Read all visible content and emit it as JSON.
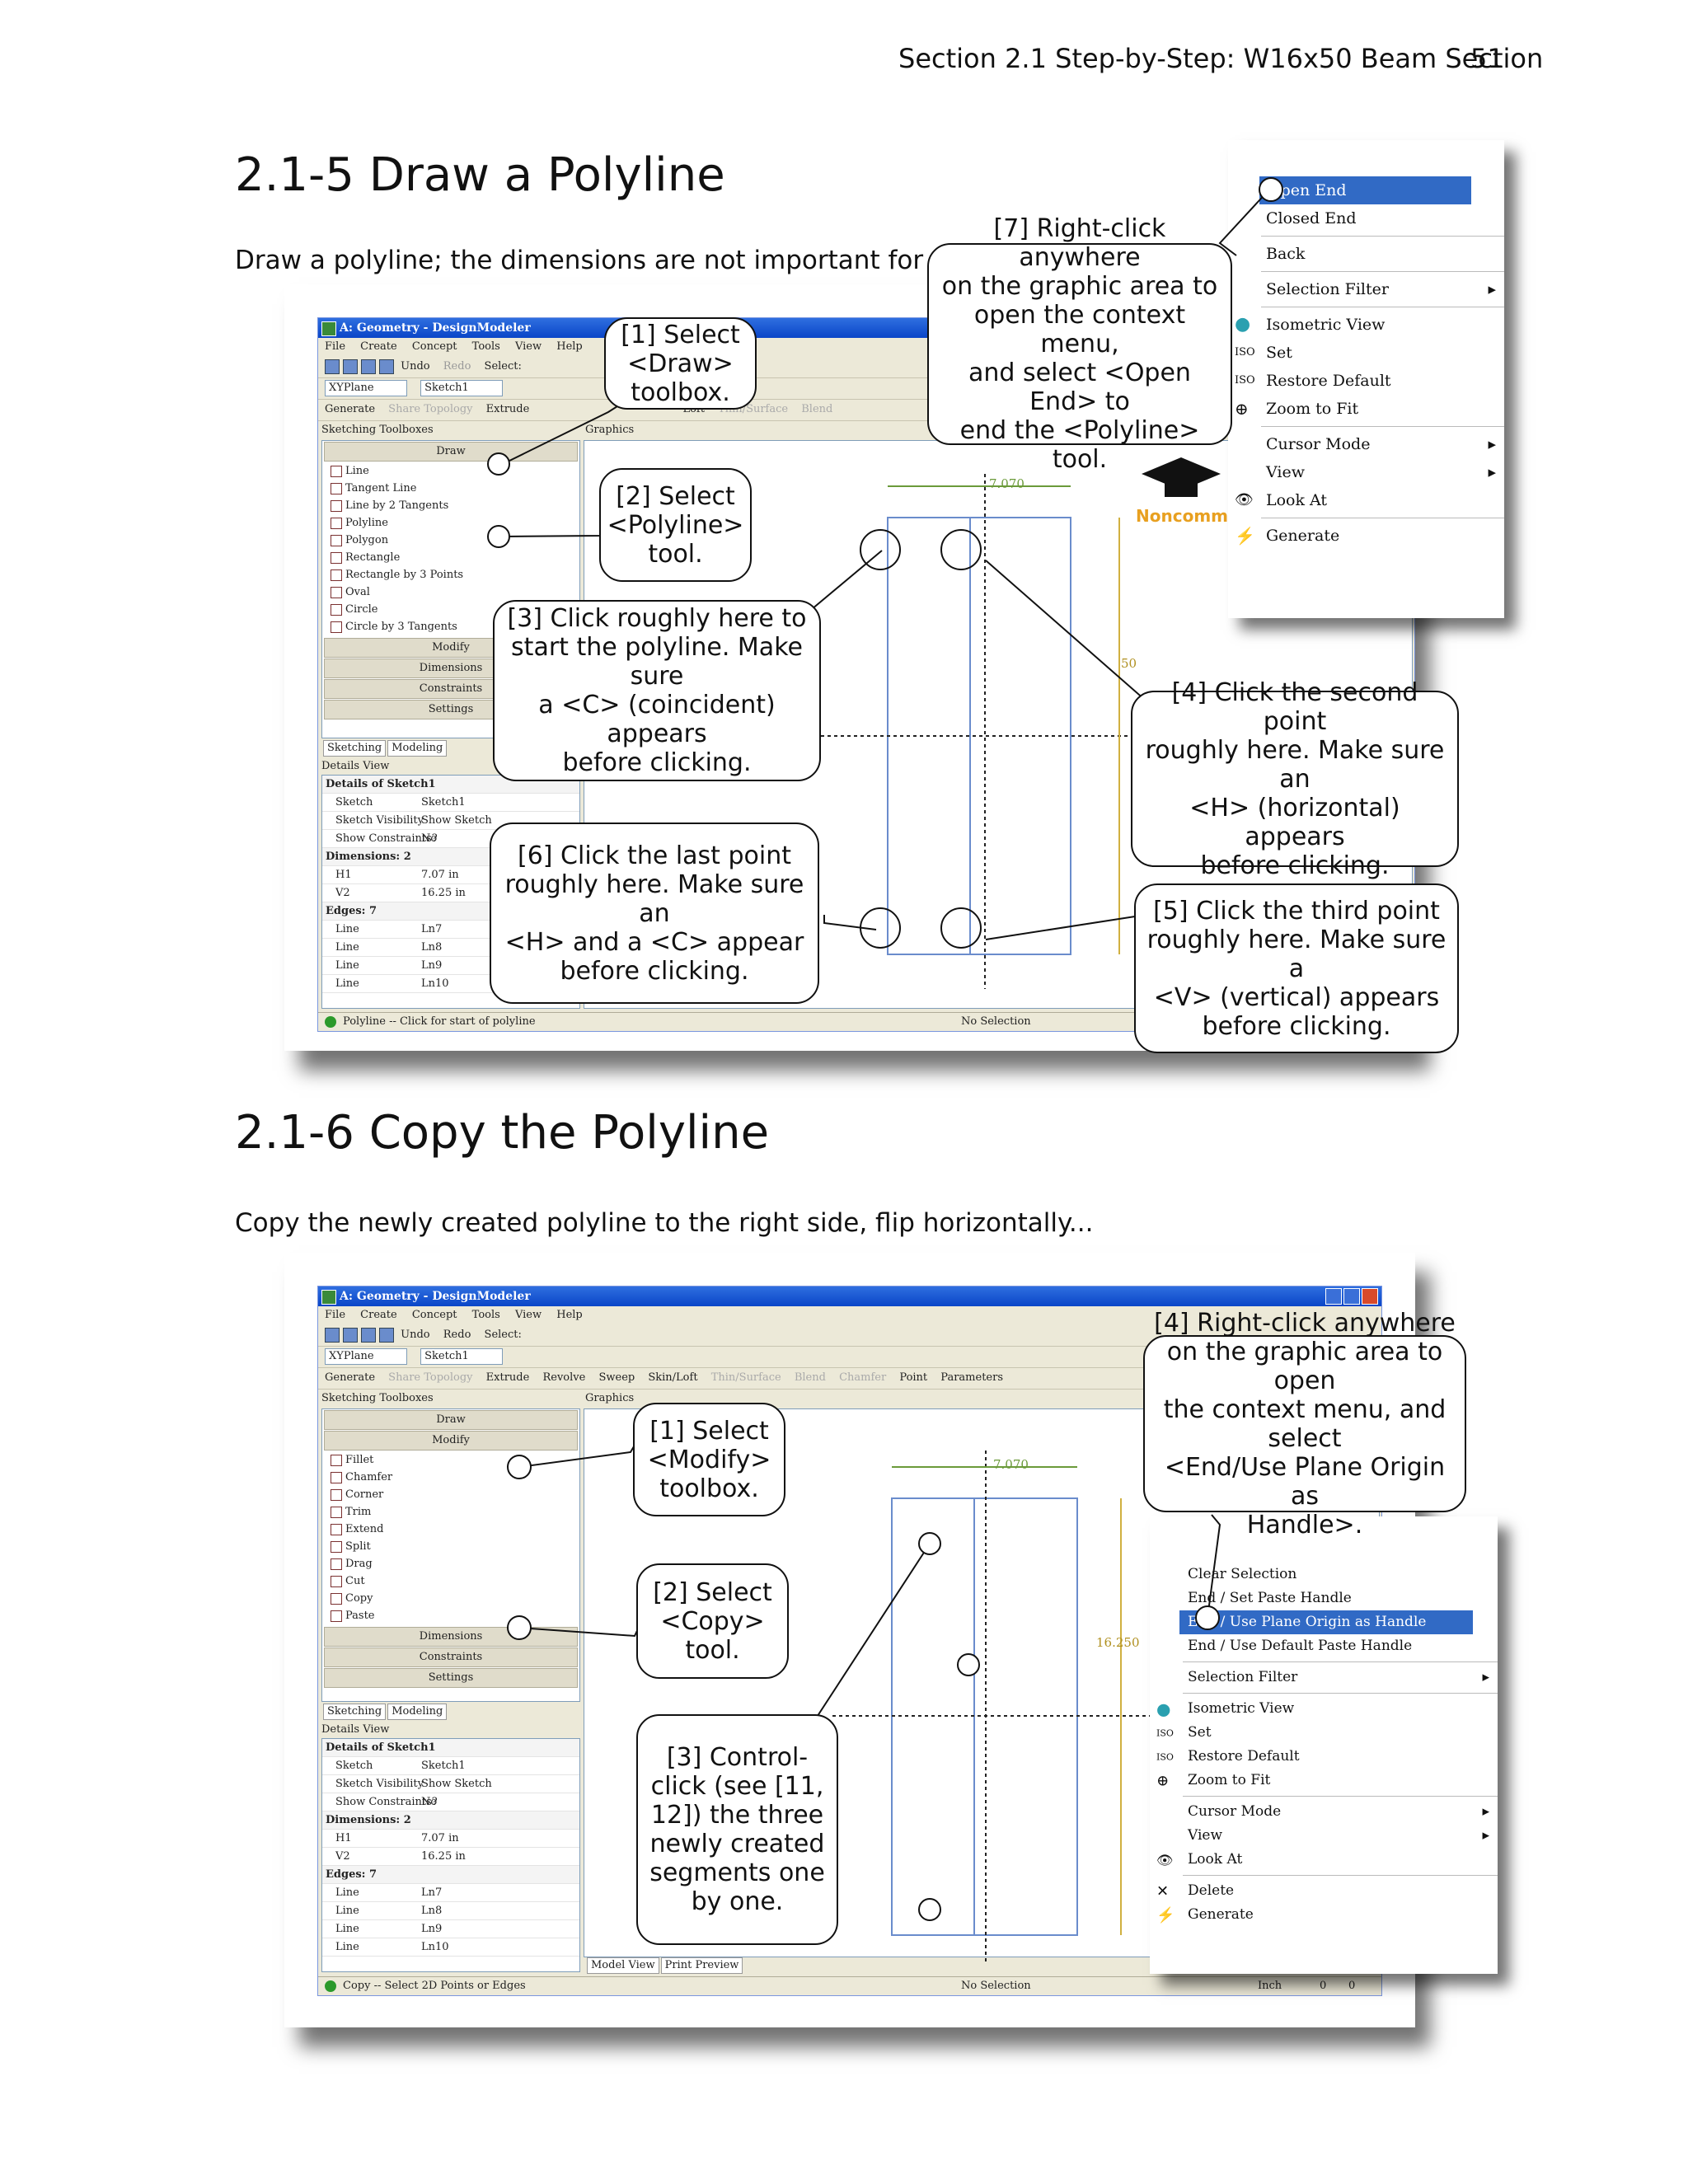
{
  "running_head": "Section 2.1  Step-by-Step: W16x50 Beam Section",
  "page_number": "51",
  "section1": {
    "heading": "2.1-5  Draw a Polyline",
    "intro": "Draw a polyline; the dimensions are not important for now...",
    "window": {
      "title": "A: Geometry - DesignModeler",
      "menu": [
        "File",
        "Create",
        "Concept",
        "Tools",
        "View",
        "Help"
      ],
      "toolbar1": {
        "undo": "Undo",
        "redo": "Redo",
        "select": "Select:"
      },
      "plane": "XYPlane",
      "sketch": "Sketch1",
      "toolbar3": {
        "generate": "Generate",
        "show_topology": "Share Topology",
        "extrude": "Extrude",
        "loft": "Loft",
        "thin": "Thin/Surface",
        "blend": "Blend"
      },
      "toolboxes_label": "Sketching Toolboxes",
      "graphics_label": "Graphics",
      "draw_header": "Draw",
      "tools": [
        "Line",
        "Tangent Line",
        "Line by 2 Tangents",
        "Polyline",
        "Polygon",
        "Rectangle",
        "Rectangle by 3 Points",
        "Oval",
        "Circle",
        "Circle by 3 Tangents"
      ],
      "other_headers": [
        "Modify",
        "Dimensions",
        "Constraints",
        "Settings"
      ],
      "tabs": [
        "Sketching",
        "Modeling"
      ],
      "details_label": "Details View",
      "details": [
        {
          "k": "Details of Sketch1",
          "v": "",
          "grp": true
        },
        {
          "k": "Sketch",
          "v": "Sketch1"
        },
        {
          "k": "Sketch Visibility",
          "v": "Show Sketch"
        },
        {
          "k": "Show Constraints?",
          "v": "No"
        },
        {
          "k": "Dimensions: 2",
          "v": "",
          "grp": true
        },
        {
          "k": "H1",
          "v": "7.07 in"
        },
        {
          "k": "V2",
          "v": "16.25 in"
        },
        {
          "k": "Edges: 7",
          "v": "",
          "grp": true
        },
        {
          "k": "Line",
          "v": "Ln7"
        },
        {
          "k": "Line",
          "v": "Ln8"
        },
        {
          "k": "Line",
          "v": "Ln9"
        },
        {
          "k": "Line",
          "v": "Ln10"
        }
      ],
      "status_left": "Polyline -- Click for start of polyline",
      "status_mid": "No Selection",
      "dim_h": "7.070",
      "dim_v": "50",
      "watermark": "Noncomm"
    },
    "context_menu": {
      "items": [
        "Open End",
        "Closed End",
        "Back",
        "Selection Filter",
        "Isometric View",
        "Set",
        "Restore Default",
        "Zoom to Fit",
        "Cursor Mode",
        "View",
        "Look At",
        "Generate"
      ]
    },
    "callouts": {
      "c1": [
        "[1] Select",
        "<Draw>",
        "toolbox."
      ],
      "c2": [
        "[2] Select",
        "<Polyline>",
        "tool."
      ],
      "c3": [
        "[3] Click roughly here to",
        "start the polyline.  Make sure",
        "a <C> (coincident) appears",
        "before clicking."
      ],
      "c4": [
        "[4] Click the second point",
        "roughly here.  Make sure an",
        "<H> (horizontal) appears",
        "before clicking."
      ],
      "c5": [
        "[5] Click the third point",
        "roughly here.  Make sure a",
        "<V> (vertical) appears",
        "before clicking."
      ],
      "c6": [
        "[6] Click the last point",
        "roughly here.  Make sure an",
        "<H> and a <C> appear",
        "before clicking."
      ],
      "c7": [
        "[7] Right-click anywhere",
        "on the graphic area to",
        "open the context menu,",
        "and select <Open End> to",
        "end the <Polyline> tool."
      ]
    }
  },
  "section2": {
    "heading": "2.1-6  Copy the Polyline",
    "intro": "Copy the newly created polyline to the right side, flip horizontally...",
    "window": {
      "title": "A: Geometry - DesignModeler",
      "menu": [
        "File",
        "Create",
        "Concept",
        "Tools",
        "View",
        "Help"
      ],
      "toolbar1": {
        "undo": "Undo",
        "redo": "Redo",
        "select": "Select:"
      },
      "plane": "XYPlane",
      "sketch": "Sketch1",
      "toolbar3": {
        "generate": "Generate",
        "show_topology": "Share Topology",
        "extrude": "Extrude",
        "revolve": "Revolve",
        "sweep": "Sweep",
        "skin": "Skin/Loft",
        "thin": "Thin/Surface",
        "blend": "Blend",
        "chamfer": "Chamfer",
        "point": "Point",
        "parameters": "Parameters"
      },
      "toolboxes_label": "Sketching Toolboxes",
      "graphics_label": "Graphics",
      "headers_top": [
        "Draw",
        "Modify"
      ],
      "tools": [
        "Fillet",
        "Chamfer",
        "Corner",
        "Trim",
        "Extend",
        "Split",
        "Drag",
        "Cut",
        "Copy",
        "Paste"
      ],
      "other_headers": [
        "Dimensions",
        "Constraints",
        "Settings"
      ],
      "tabs": [
        "Sketching",
        "Modeling"
      ],
      "details_label": "Details View",
      "details": [
        {
          "k": "Details of Sketch1",
          "v": "",
          "grp": true
        },
        {
          "k": "Sketch",
          "v": "Sketch1"
        },
        {
          "k": "Sketch Visibility",
          "v": "Show Sketch"
        },
        {
          "k": "Show Constraints?",
          "v": "No"
        },
        {
          "k": "Dimensions: 2",
          "v": "",
          "grp": true
        },
        {
          "k": "H1",
          "v": "7.07 in"
        },
        {
          "k": "V2",
          "v": "16.25 in"
        },
        {
          "k": "Edges: 7",
          "v": "",
          "grp": true
        },
        {
          "k": "Line",
          "v": "Ln7"
        },
        {
          "k": "Line",
          "v": "Ln8"
        },
        {
          "k": "Line",
          "v": "Ln9"
        },
        {
          "k": "Line",
          "v": "Ln10"
        }
      ],
      "bottom_tabs": [
        "Model View",
        "Print Preview"
      ],
      "status_left": "Copy -- Select 2D Points or Edges",
      "status_mid": "No Selection",
      "status_unit": "Inch",
      "status_v1": "0",
      "status_v2": "0",
      "dim_h": "7.070",
      "dim_v": "16.250"
    },
    "context_menu": {
      "items": [
        "Clear Selection",
        "End / Set Paste Handle",
        "End / Use Plane Origin as Handle",
        "End / Use Default Paste Handle",
        "Selection Filter",
        "Isometric View",
        "Set",
        "Restore Default",
        "Zoom to Fit",
        "Cursor Mode",
        "View",
        "Look At",
        "Delete",
        "Generate"
      ]
    },
    "callouts": {
      "c1": [
        "[1] Select",
        "<Modify>",
        "toolbox."
      ],
      "c2": [
        "[2] Select",
        "<Copy>",
        "tool."
      ],
      "c3": [
        "[3] Control-",
        "click (see [11,",
        "12]) the three",
        "newly created",
        "segments one",
        "by one."
      ],
      "c4": [
        "[4] Right-click anywhere",
        "on the graphic area to open",
        "the context menu, and select",
        "<End/Use Plane Origin as",
        "Handle>."
      ]
    }
  }
}
